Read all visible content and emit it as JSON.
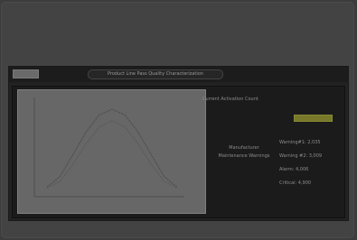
{
  "window": {
    "title": "Product Line Pass Quality Characterization"
  },
  "status": {
    "label": "Current Activation Count",
    "indicator_color": "#77782a"
  },
  "legend": {
    "title": "Manufacturer Maintenance Warnings",
    "values": [
      "Warning#1: 2,035",
      "Warning #2: 3,009",
      "Alarm: 4,006",
      "Critical: 4,900"
    ]
  },
  "chart_data": {
    "type": "line",
    "x": [
      0,
      1,
      2,
      3,
      4,
      5,
      6,
      7,
      8,
      9,
      10
    ],
    "series": [
      {
        "values": [
          0.05,
          0.18,
          0.45,
          0.72,
          0.93,
          1.0,
          0.93,
          0.72,
          0.45,
          0.18,
          0.05
        ]
      },
      {
        "values": [
          0.04,
          0.12,
          0.33,
          0.58,
          0.78,
          0.86,
          0.78,
          0.58,
          0.33,
          0.12,
          0.04
        ]
      }
    ],
    "ylim": [
      0,
      1.1
    ],
    "colors": [
      "#4f4f4f",
      "#5a5a5a"
    ],
    "title": "",
    "xlabel": "",
    "ylabel": ""
  }
}
